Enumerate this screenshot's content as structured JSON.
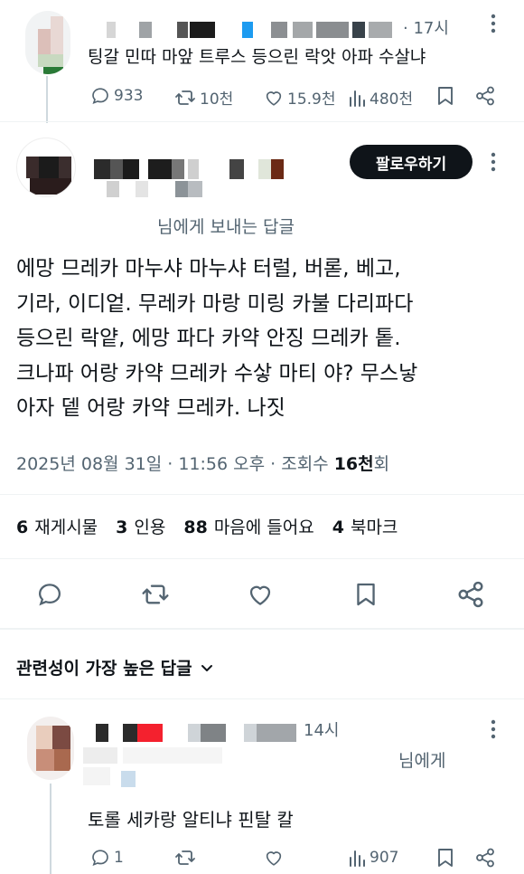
{
  "parent_tweet": {
    "time": "· 17시",
    "text": "팅갈 민따 마앞 트루스 등으린 락앗 아파 수살냐",
    "stats": {
      "replies": "933",
      "retweets": "10천",
      "likes": "15.9천",
      "views": "480천"
    }
  },
  "main_tweet": {
    "follow_label": "팔로우하기",
    "reply_to": "님에게 보내는 답글",
    "text_lines": [
      "에망 므레카 마누샤 마누샤 터럴, 버롣, 베고,",
      "기라, 이디엍. 무레카 마랑 미링 카불 다리파다",
      "등으린 락얕, 에망 파다 카약 안징 므레카 톹.",
      "크나파 어랑 카약 므레카 수샇 마티 야? 무스낳",
      "아자 뎉 어랑 카약 므레카. 나짓"
    ],
    "meta": {
      "datetime": "2025년 08월 31일 · 11:56 오후 · 조회수 ",
      "views_count": "16천",
      "views_suffix": "회"
    },
    "counts": [
      {
        "num": "6",
        "label": "재게시물"
      },
      {
        "num": "3",
        "label": "인용"
      },
      {
        "num": "88",
        "label": "마음에 들어요"
      },
      {
        "num": "4",
        "label": "북마크"
      }
    ]
  },
  "sort": {
    "label": "관련성이 가장 높은 답글"
  },
  "reply_tweet": {
    "time": "14시",
    "reply_to": "님에게",
    "text": "토롤 세카랑 알티냐 핀탈 칼",
    "stats": {
      "replies": "1",
      "views": "907"
    }
  },
  "colors": {
    "text": "#0f1419",
    "muted": "#536471",
    "divider": "#eff3f4",
    "blue": "#1d9bf0",
    "red": "#f4212e"
  }
}
